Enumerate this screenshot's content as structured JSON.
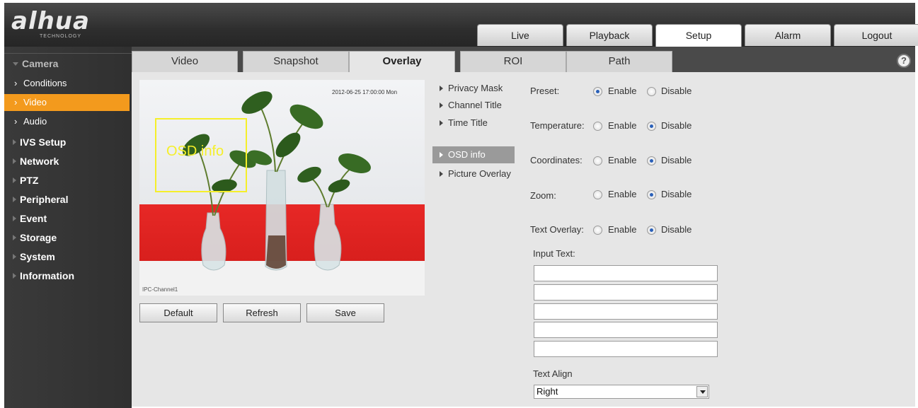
{
  "brand": {
    "name": "alhua",
    "subtitle": "TECHNOLOGY"
  },
  "topnav": [
    "Live",
    "Playback",
    "Setup",
    "Alarm",
    "Logout"
  ],
  "topnav_active": "Setup",
  "sidebar": {
    "categories": [
      {
        "label": "Camera",
        "open": true
      },
      {
        "label": "IVS Setup"
      },
      {
        "label": "Network"
      },
      {
        "label": "PTZ"
      },
      {
        "label": "Peripheral"
      },
      {
        "label": "Event"
      },
      {
        "label": "Storage"
      },
      {
        "label": "System"
      },
      {
        "label": "Information"
      }
    ],
    "camera_sub": [
      "Conditions",
      "Video",
      "Audio"
    ],
    "selected_sub": "Video"
  },
  "tabs": [
    "Video",
    "Snapshot",
    "Overlay",
    "ROI",
    "Path"
  ],
  "active_tab": "Overlay",
  "preview": {
    "osd_time": "2012-06-25 17:00:00 Mon",
    "osd_channel": "IPC-Channel1",
    "osd_label": "OSD info"
  },
  "buttons": {
    "default": "Default",
    "refresh": "Refresh",
    "save": "Save"
  },
  "overlay_menu": [
    "Privacy Mask",
    "Channel Title",
    "Time Title",
    "OSD info",
    "Picture Overlay"
  ],
  "overlay_menu_active": "OSD info",
  "settings": {
    "enable_label": "Enable",
    "disable_label": "Disable",
    "rows": [
      {
        "label": "Preset:",
        "value": "Enable"
      },
      {
        "label": "Temperature:",
        "value": "Disable"
      },
      {
        "label": "Coordinates:",
        "value": "Disable"
      },
      {
        "label": "Zoom:",
        "value": "Disable"
      },
      {
        "label": "Text Overlay:",
        "value": "Disable"
      }
    ],
    "input_text_label": "Input Text:",
    "input_values": [
      "",
      "",
      "",
      "",
      ""
    ],
    "text_align_label": "Text Align",
    "text_align_value": "Right"
  },
  "colors": {
    "accent": "#f39a1d",
    "osd": "#f5ef2a",
    "radio_dot": "#2a60b8"
  }
}
